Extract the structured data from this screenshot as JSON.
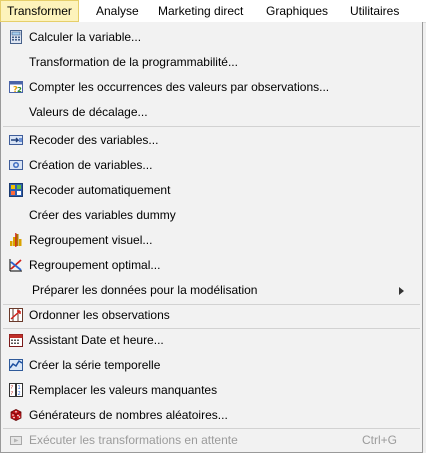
{
  "menubar": {
    "items": [
      "Transformer",
      "Analyse",
      "Marketing direct",
      "Graphiques",
      "Utilitaires"
    ]
  },
  "menu": {
    "items": [
      {
        "label": "Calculer la variable...",
        "icon": "calculator-icon"
      },
      {
        "label": "Transformation de la programmabilité...",
        "icon": ""
      },
      {
        "label": "Compter les occurrences des valeurs par observations...",
        "icon": "count-values-icon"
      },
      {
        "label": "Valeurs de décalage...",
        "icon": ""
      },
      {
        "label": "Recoder des variables...",
        "icon": "recode-icon"
      },
      {
        "label": "Création de variables...",
        "icon": "create-variables-icon"
      },
      {
        "label": "Recoder automatiquement",
        "icon": "auto-recode-icon"
      },
      {
        "label": "Créer des variables dummy",
        "icon": ""
      },
      {
        "label": "Regroupement visuel...",
        "icon": "visual-binning-icon"
      },
      {
        "label": "Regroupement optimal...",
        "icon": "optimal-binning-icon"
      },
      {
        "label": "Préparer les données pour la modélisation",
        "icon": "",
        "submenu": true
      },
      {
        "label": "Ordonner les observations",
        "icon": "rank-cases-icon"
      },
      {
        "label": "Assistant Date et heure...",
        "icon": "date-wizard-icon"
      },
      {
        "label": "Créer la série temporelle",
        "icon": "time-series-icon"
      },
      {
        "label": "Remplacer les valeurs manquantes",
        "icon": "missing-values-icon"
      },
      {
        "label": "Générateurs de nombres aléatoires...",
        "icon": "dice-icon"
      },
      {
        "label": "Exécuter les transformations en attente",
        "icon": "run-pending-icon",
        "shortcut": "Ctrl+G",
        "disabled": true
      }
    ]
  },
  "colors": {
    "active_menu_bg": "#fdf3bb",
    "menu_bg": "#f2f2f2",
    "disabled_text": "#9b9b9b"
  }
}
